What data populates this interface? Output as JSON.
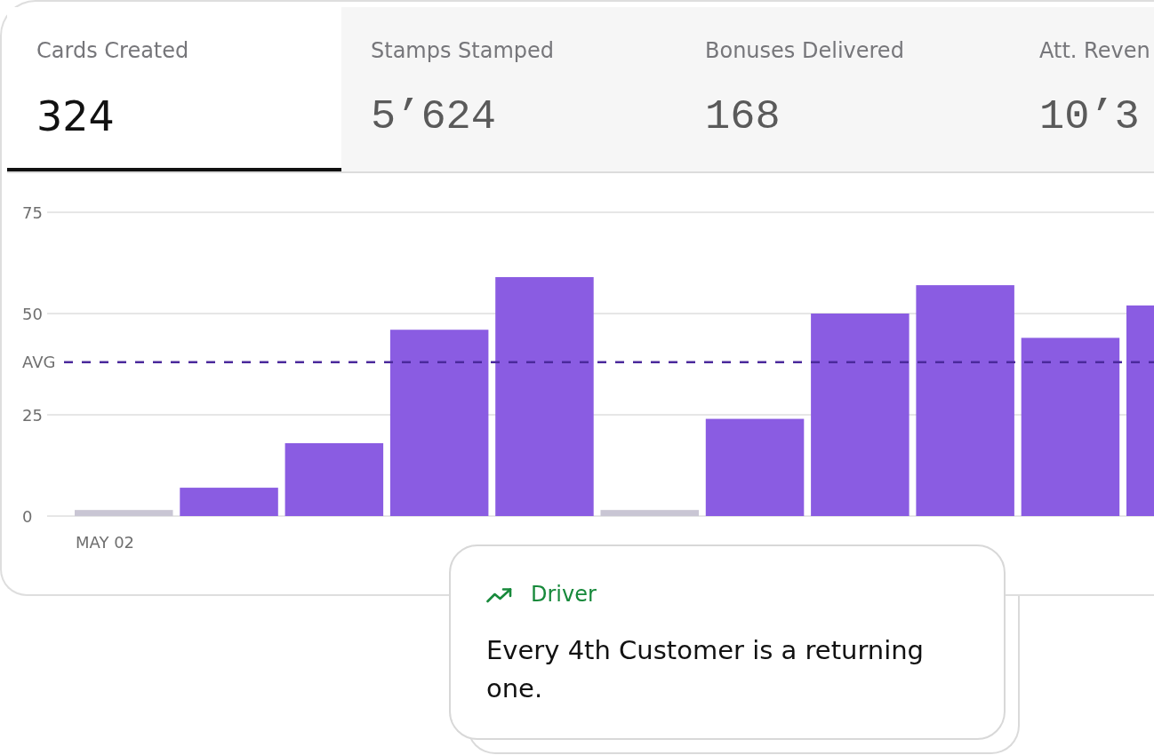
{
  "metrics": {
    "tabs": [
      {
        "label": "Cards Created",
        "value": "324",
        "selected": true
      },
      {
        "label": "Stamps Stamped",
        "value": "5’624",
        "selected": false
      },
      {
        "label": "Bonuses Delivered",
        "value": "168",
        "selected": false
      },
      {
        "label": "Att. Reven",
        "value": "10’3",
        "selected": false
      }
    ]
  },
  "chart": {
    "chart_data": {
      "type": "bar",
      "stacked": true,
      "categories": [
        "MAY 02",
        null,
        null,
        null,
        null,
        null,
        null,
        null,
        null,
        null,
        null
      ],
      "series": [
        {
          "color": "#8a5ce2",
          "values": [
            0,
            7,
            18,
            46,
            59,
            0,
            24,
            50,
            57,
            44,
            52
          ]
        },
        {
          "color": "#c9c6d4",
          "values": [
            1.5,
            0,
            0,
            0,
            0,
            1.5,
            0,
            0,
            0,
            0,
            0
          ]
        }
      ],
      "yticks": [
        0,
        25,
        50,
        75
      ],
      "ylim": [
        0,
        75
      ],
      "ref_lines": [
        {
          "axis": "y",
          "value": 38,
          "label": "AVG"
        }
      ]
    }
  },
  "insight": {
    "category": "Driver",
    "text": "Every 4th Customer is a returning one."
  }
}
